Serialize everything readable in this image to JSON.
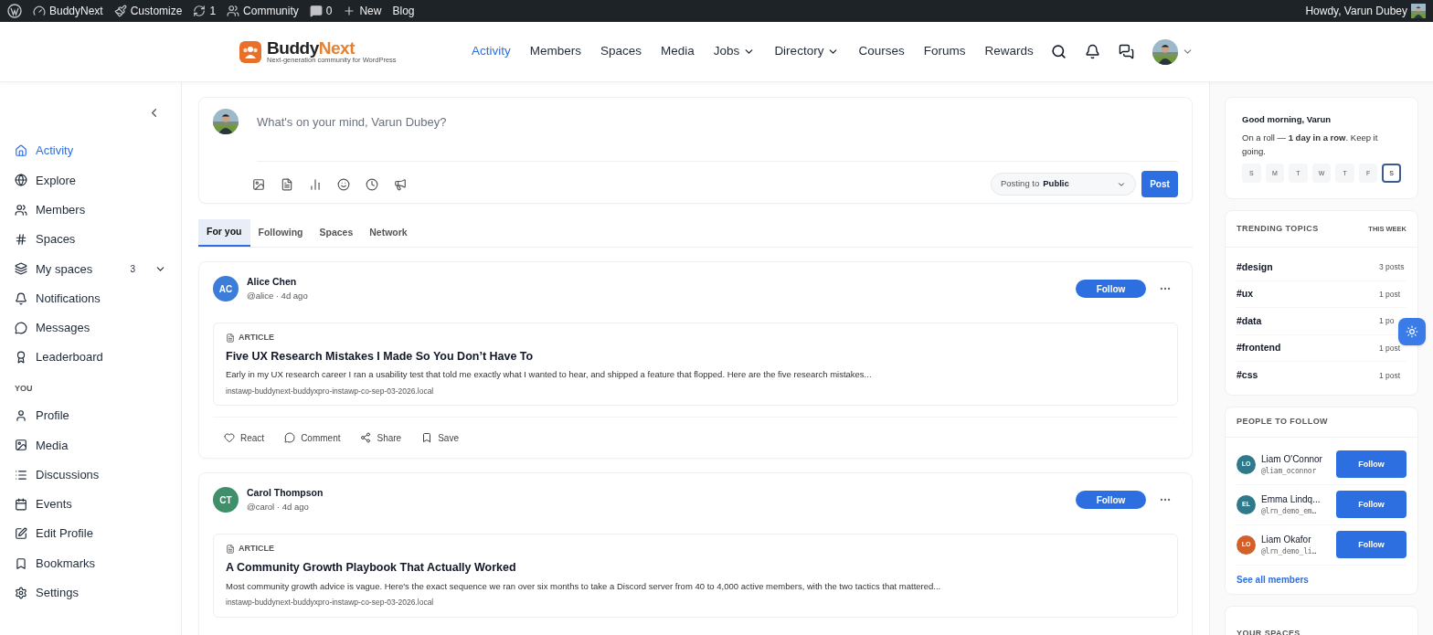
{
  "admin_bar": {
    "items": [
      {
        "kind": "wp"
      },
      {
        "kind": "site",
        "label": "BuddyNext"
      },
      {
        "kind": "customize",
        "label": "Customize"
      },
      {
        "kind": "updates",
        "label": "1"
      },
      {
        "kind": "community",
        "label": "Community"
      },
      {
        "kind": "comments",
        "label": "0"
      },
      {
        "kind": "new",
        "label": "New"
      },
      {
        "kind": "plain",
        "label": "Blog"
      }
    ],
    "greeting": "Howdy, Varun Dubey"
  },
  "header": {
    "logo": {
      "name_first": "Buddy",
      "name_second": "Next",
      "tagline": "Next-generation community for WordPress"
    },
    "nav": [
      {
        "label": "Activity",
        "selected": true,
        "dropdown": false
      },
      {
        "label": "Members",
        "selected": false,
        "dropdown": false
      },
      {
        "label": "Spaces",
        "selected": false,
        "dropdown": false
      },
      {
        "label": "Media",
        "selected": false,
        "dropdown": false
      },
      {
        "label": "Jobs",
        "selected": false,
        "dropdown": true
      },
      {
        "label": "Directory",
        "selected": false,
        "dropdown": true
      },
      {
        "label": "Courses",
        "selected": false,
        "dropdown": false
      },
      {
        "label": "Forums",
        "selected": false,
        "dropdown": false
      },
      {
        "label": "Rewards",
        "selected": false,
        "dropdown": false
      }
    ]
  },
  "sidebar": {
    "items": [
      {
        "label": "Activity",
        "selected": true
      },
      {
        "label": "Explore",
        "selected": false
      },
      {
        "label": "Members",
        "selected": false
      },
      {
        "label": "Spaces",
        "selected": false
      },
      {
        "label": "My spaces",
        "selected": false,
        "count": "3"
      },
      {
        "label": "Notifications",
        "selected": false
      },
      {
        "label": "Messages",
        "selected": false
      },
      {
        "label": "Leaderboard",
        "selected": false
      }
    ],
    "section_title": "YOU",
    "you_items": [
      {
        "label": "Profile",
        "selected": false
      },
      {
        "label": "Media",
        "selected": false
      },
      {
        "label": "Discussions",
        "selected": false
      },
      {
        "label": "Events",
        "selected": false
      },
      {
        "label": "Edit Profile",
        "selected": false
      },
      {
        "label": "Bookmarks",
        "selected": false
      },
      {
        "label": "Settings",
        "selected": false
      }
    ]
  },
  "composer": {
    "placeholder": "What's on your mind, Varun Dubey?",
    "posting_label": "Posting to",
    "audience": "Public",
    "post_button": "Post"
  },
  "feed_tabs": [
    {
      "label": "For you",
      "selected": true
    },
    {
      "label": "Following",
      "selected": false
    },
    {
      "label": "Spaces",
      "selected": false
    },
    {
      "label": "Network",
      "selected": false
    }
  ],
  "posts": [
    {
      "initials": "AC",
      "color": "#3b7dd8",
      "name": "Alice Chen",
      "meta": "@alice · 4d ago",
      "follow": "Follow",
      "article": {
        "label": "ARTICLE",
        "title": "Five UX Research Mistakes I Made So You Don’t Have To",
        "excerpt": "Early in my UX research career I ran a usability test that told me exactly what I wanted to hear, and shipped a feature that flopped. Here are the five research mistakes...",
        "url": "instawp-buddynext-buddyxpro-instawp-co-sep-03-2026.local"
      },
      "actions": [
        "React",
        "Comment",
        "Share",
        "Save"
      ]
    },
    {
      "initials": "CT",
      "color": "#3f8f6a",
      "name": "Carol Thompson",
      "meta": "@carol · 4d ago",
      "follow": "Follow",
      "article": {
        "label": "ARTICLE",
        "title": "A Community Growth Playbook That Actually Worked",
        "excerpt": "Most community growth advice is vague. Here's the exact sequence we ran over six months to take a Discord server from 40 to 4,000 active members, with the two tactics that mattered...",
        "url": "instawp-buddynext-buddyxpro-instawp-co-sep-03-2026.local"
      }
    }
  ],
  "streak": {
    "title": "Good morning, Varun",
    "text": "On a roll — **1 day in a row**. Keep it going.",
    "days": [
      {
        "label": "S",
        "today": false
      },
      {
        "label": "M",
        "today": false
      },
      {
        "label": "T",
        "today": false
      },
      {
        "label": "W",
        "today": false
      },
      {
        "label": "T",
        "today": false
      },
      {
        "label": "F",
        "today": false
      },
      {
        "label": "S",
        "today": true
      }
    ]
  },
  "trending": {
    "title": "TRENDING TOPICS",
    "period": "THIS WEEK",
    "topics": [
      {
        "tag": "#design",
        "count": "3 posts"
      },
      {
        "tag": "#ux",
        "count": "1 post"
      },
      {
        "tag": "#data",
        "count": "1 po"
      },
      {
        "tag": "#frontend",
        "count": "1 post"
      },
      {
        "tag": "#css",
        "count": "1 post"
      }
    ]
  },
  "people": {
    "title": "PEOPLE TO FOLLOW",
    "people": [
      {
        "initials": "LO",
        "color": "#2f7a8a",
        "name": "Liam O'Connor",
        "handle": "@liam_oconnor",
        "button": "Follow"
      },
      {
        "initials": "EL",
        "color": "#2f7a8a",
        "name": "Emma Lindq...",
        "handle": "@lrn_demo_em…",
        "button": "Follow"
      },
      {
        "initials": "LO",
        "color": "#d2602a",
        "name": "Liam Okafor",
        "handle": "@lrn_demo_li…",
        "button": "Follow"
      }
    ],
    "link": "See all members"
  },
  "your_spaces": {
    "title": "YOUR SPACES"
  }
}
